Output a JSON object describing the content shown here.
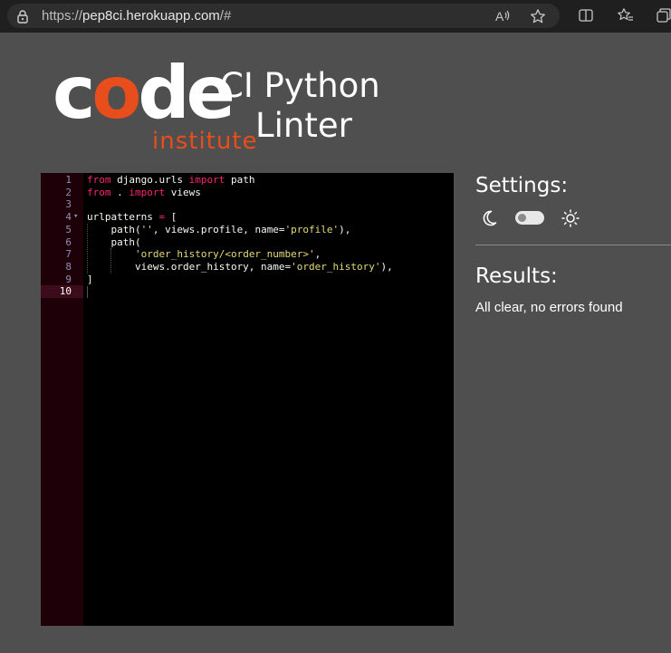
{
  "browser": {
    "url_prefix": "https://",
    "url_domain": "pep8ci.herokuapp.com",
    "url_suffix": "/#"
  },
  "logo": {
    "code_c": "c",
    "code_o": "o",
    "code_de": "de",
    "institute": "institute"
  },
  "app_title": {
    "line1": "CI Python",
    "line2": "Linter"
  },
  "editor": {
    "active_line": 10,
    "lines": [
      {
        "num": "1",
        "fold": "",
        "tokens": [
          {
            "t": "kw",
            "v": "from"
          },
          {
            "t": "id",
            "v": " django.urls "
          },
          {
            "t": "kw",
            "v": "import"
          },
          {
            "t": "id",
            "v": " path"
          }
        ]
      },
      {
        "num": "2",
        "fold": "",
        "tokens": [
          {
            "t": "kw",
            "v": "from"
          },
          {
            "t": "id",
            "v": " . "
          },
          {
            "t": "kw",
            "v": "import"
          },
          {
            "t": "id",
            "v": " views"
          }
        ]
      },
      {
        "num": "3",
        "fold": "",
        "tokens": []
      },
      {
        "num": "4",
        "fold": "▾",
        "tokens": [
          {
            "t": "id",
            "v": "urlpatterns "
          },
          {
            "t": "kw",
            "v": "="
          },
          {
            "t": "id",
            "v": " ["
          }
        ]
      },
      {
        "num": "5",
        "fold": "",
        "tokens": [
          {
            "t": "id",
            "v": "    path("
          },
          {
            "t": "str",
            "v": "''"
          },
          {
            "t": "id",
            "v": ", views.profile, name="
          },
          {
            "t": "str",
            "v": "'profile'"
          },
          {
            "t": "id",
            "v": "),"
          }
        ]
      },
      {
        "num": "6",
        "fold": "",
        "tokens": [
          {
            "t": "id",
            "v": "    path("
          }
        ]
      },
      {
        "num": "7",
        "fold": "",
        "tokens": [
          {
            "t": "id",
            "v": "        "
          },
          {
            "t": "str",
            "v": "'order_history/<order_number>'"
          },
          {
            "t": "id",
            "v": ","
          }
        ]
      },
      {
        "num": "8",
        "fold": "",
        "tokens": [
          {
            "t": "id",
            "v": "        views.order_history, name="
          },
          {
            "t": "str",
            "v": "'order_history'"
          },
          {
            "t": "id",
            "v": "),"
          }
        ]
      },
      {
        "num": "9",
        "fold": "",
        "tokens": [
          {
            "t": "id",
            "v": "]"
          }
        ]
      },
      {
        "num": "10",
        "fold": "",
        "tokens": []
      }
    ]
  },
  "settings": {
    "heading": "Settings:",
    "dark_mode_icon": "moon-icon",
    "light_mode_icon": "sun-icon",
    "theme_toggle_on": false
  },
  "results": {
    "heading": "Results:",
    "message": "All clear, no errors found"
  },
  "colors": {
    "brand_orange": "#e84e1b",
    "page_bg": "#4f4f4f",
    "editor_bg": "#000000",
    "gutter_bg": "#1e0008",
    "keyword": "#f92672",
    "string": "#e6db74"
  }
}
